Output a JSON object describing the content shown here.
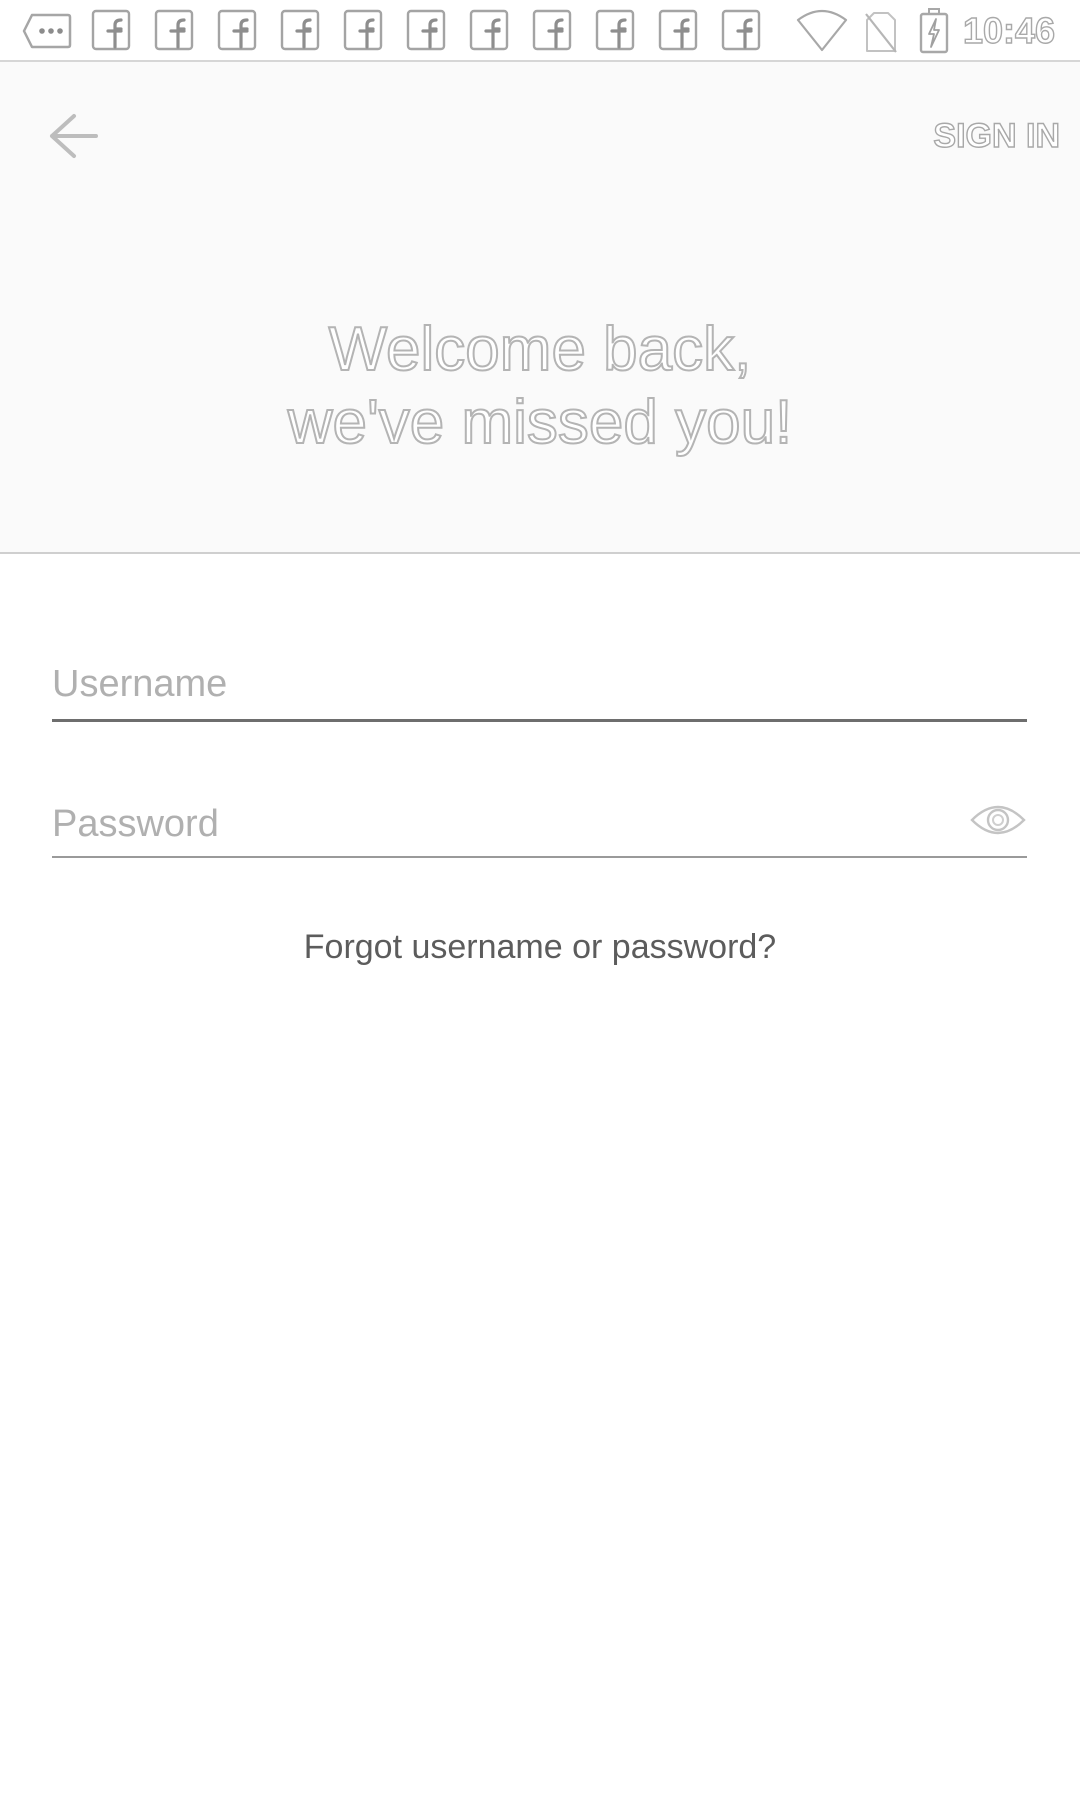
{
  "status_bar": {
    "time": "10:46",
    "icons": {
      "messages": "message-icon",
      "notifications": "facebook-icon",
      "notification_count": 11,
      "wifi": "wifi-icon",
      "sim": "no-sim-icon",
      "battery": "battery-charging-icon"
    }
  },
  "header": {
    "back_icon": "arrow-left-icon",
    "signin_label": "SIGN IN",
    "welcome_line1": "Welcome back,",
    "welcome_line2": "we've missed you!"
  },
  "form": {
    "username": {
      "value": "",
      "placeholder": "Username"
    },
    "password": {
      "value": "",
      "placeholder": "Password",
      "toggle_icon": "eye-icon"
    },
    "forgot_label": "Forgot username or password?"
  },
  "colors": {
    "background": "#ffffff",
    "header_background": "#fafafa",
    "outline_text": "#b4b4b4",
    "placeholder": "#b0b0b0",
    "underline_active": "#6e6e6e"
  }
}
